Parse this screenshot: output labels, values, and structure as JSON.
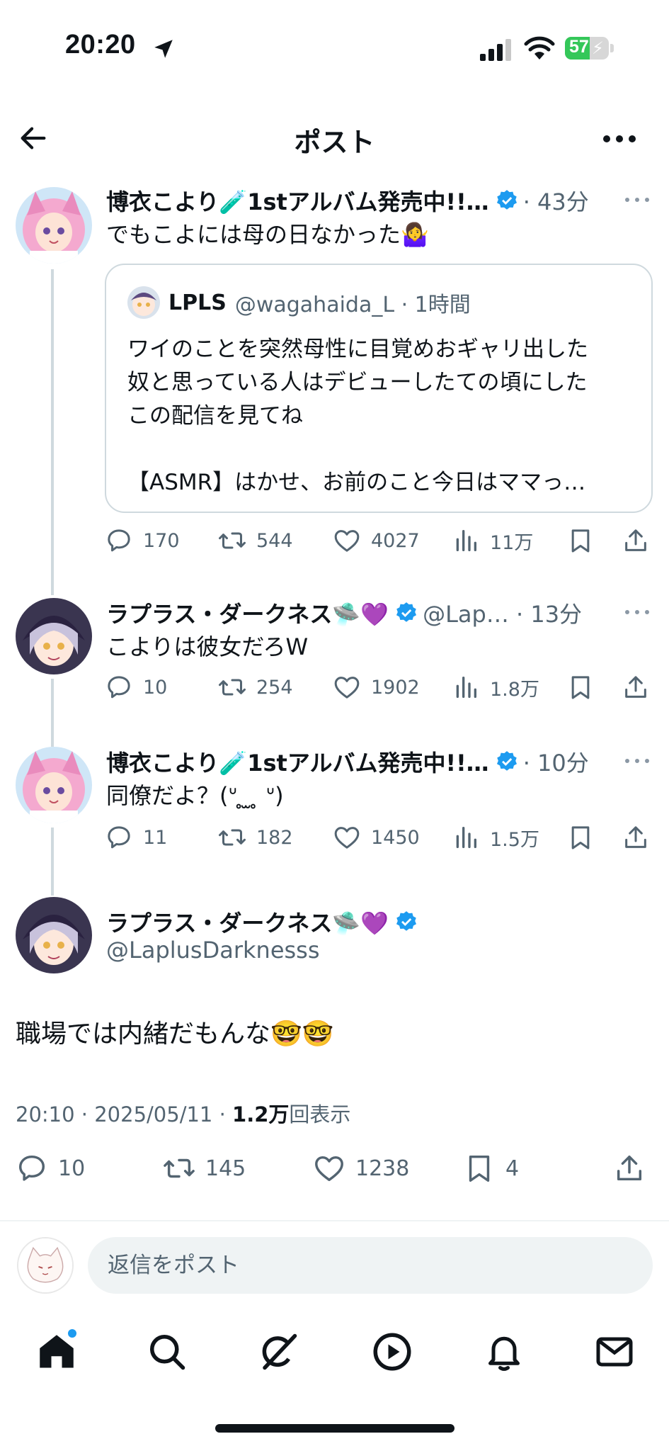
{
  "status_bar": {
    "time": "20:20",
    "battery": "57",
    "battery_level": 0.57
  },
  "nav": {
    "title": "ポスト"
  },
  "tweets": [
    {
      "name": "博衣こより🧪1stアルバム発売中!!…",
      "meta": "· 43分",
      "text": "でもこよには母の日なかった🤷‍♀️",
      "quote": {
        "name": "LPLS",
        "meta": "@wagahaida_L · 1時間",
        "line1": "ワイのことを突然母性に目覚めおギャリ出した",
        "line2": "奴と思っている人はデビューしたての頃にした",
        "line3": "この配信を見てね",
        "line4": "【ASMR】はかせ、お前のこと今日はママっ…"
      },
      "replies": "170",
      "retweets": "544",
      "likes": "4027",
      "views": "11万"
    },
    {
      "name": "ラプラス・ダークネス🛸💜",
      "meta": "@Lap… · 13分",
      "text": "こよりは彼女だろW",
      "replies": "10",
      "retweets": "254",
      "likes": "1902",
      "views": "1.8万"
    },
    {
      "name": "博衣こより🧪1stアルバム発売中!!…",
      "meta": "· 10分",
      "text": "同僚だよ？(ᐡ ̥ ̫ ̥ ᐡ)",
      "replies": "11",
      "retweets": "182",
      "likes": "1450",
      "views": "1.5万"
    }
  ],
  "main_tweet": {
    "name": "ラプラス・ダークネス🛸💜",
    "handle": "@LaplusDarknesss",
    "text": "職場では内緒だもんな🤓🤓",
    "meta_prefix": "20:10 · 2025/05/11 · ",
    "views": "1.2万",
    "views_label": "回表示",
    "replies": "10",
    "retweets": "145",
    "likes": "1238",
    "bookmarks": "4"
  },
  "reply_box": {
    "placeholder": "返信をポスト"
  },
  "colors": {
    "accent": "#1d9bf0",
    "secondary_text": "#536471",
    "border": "#cfd9de"
  },
  "icons": [
    "location-arrow-icon",
    "signal-icon",
    "wifi-icon",
    "battery-icon",
    "back-arrow-icon",
    "more-icon",
    "verified-badge-icon",
    "reply-icon",
    "retweet-icon",
    "like-icon",
    "views-icon",
    "bookmark-icon",
    "share-icon",
    "home-icon",
    "search-icon",
    "grok-icon",
    "video-icon",
    "notifications-icon",
    "messages-icon"
  ]
}
